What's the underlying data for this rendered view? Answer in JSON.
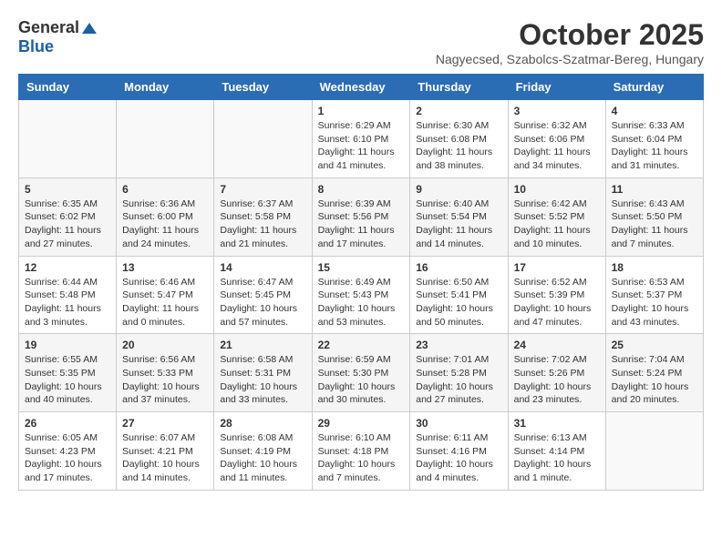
{
  "logo": {
    "general": "General",
    "blue": "Blue"
  },
  "title": "October 2025",
  "location": "Nagyecsed, Szabolcs-Szatmar-Bereg, Hungary",
  "headers": [
    "Sunday",
    "Monday",
    "Tuesday",
    "Wednesday",
    "Thursday",
    "Friday",
    "Saturday"
  ],
  "weeks": [
    [
      {
        "day": "",
        "info": ""
      },
      {
        "day": "",
        "info": ""
      },
      {
        "day": "",
        "info": ""
      },
      {
        "day": "1",
        "info": "Sunrise: 6:29 AM\nSunset: 6:10 PM\nDaylight: 11 hours\nand 41 minutes."
      },
      {
        "day": "2",
        "info": "Sunrise: 6:30 AM\nSunset: 6:08 PM\nDaylight: 11 hours\nand 38 minutes."
      },
      {
        "day": "3",
        "info": "Sunrise: 6:32 AM\nSunset: 6:06 PM\nDaylight: 11 hours\nand 34 minutes."
      },
      {
        "day": "4",
        "info": "Sunrise: 6:33 AM\nSunset: 6:04 PM\nDaylight: 11 hours\nand 31 minutes."
      }
    ],
    [
      {
        "day": "5",
        "info": "Sunrise: 6:35 AM\nSunset: 6:02 PM\nDaylight: 11 hours\nand 27 minutes."
      },
      {
        "day": "6",
        "info": "Sunrise: 6:36 AM\nSunset: 6:00 PM\nDaylight: 11 hours\nand 24 minutes."
      },
      {
        "day": "7",
        "info": "Sunrise: 6:37 AM\nSunset: 5:58 PM\nDaylight: 11 hours\nand 21 minutes."
      },
      {
        "day": "8",
        "info": "Sunrise: 6:39 AM\nSunset: 5:56 PM\nDaylight: 11 hours\nand 17 minutes."
      },
      {
        "day": "9",
        "info": "Sunrise: 6:40 AM\nSunset: 5:54 PM\nDaylight: 11 hours\nand 14 minutes."
      },
      {
        "day": "10",
        "info": "Sunrise: 6:42 AM\nSunset: 5:52 PM\nDaylight: 11 hours\nand 10 minutes."
      },
      {
        "day": "11",
        "info": "Sunrise: 6:43 AM\nSunset: 5:50 PM\nDaylight: 11 hours\nand 7 minutes."
      }
    ],
    [
      {
        "day": "12",
        "info": "Sunrise: 6:44 AM\nSunset: 5:48 PM\nDaylight: 11 hours\nand 3 minutes."
      },
      {
        "day": "13",
        "info": "Sunrise: 6:46 AM\nSunset: 5:47 PM\nDaylight: 11 hours\nand 0 minutes."
      },
      {
        "day": "14",
        "info": "Sunrise: 6:47 AM\nSunset: 5:45 PM\nDaylight: 10 hours\nand 57 minutes."
      },
      {
        "day": "15",
        "info": "Sunrise: 6:49 AM\nSunset: 5:43 PM\nDaylight: 10 hours\nand 53 minutes."
      },
      {
        "day": "16",
        "info": "Sunrise: 6:50 AM\nSunset: 5:41 PM\nDaylight: 10 hours\nand 50 minutes."
      },
      {
        "day": "17",
        "info": "Sunrise: 6:52 AM\nSunset: 5:39 PM\nDaylight: 10 hours\nand 47 minutes."
      },
      {
        "day": "18",
        "info": "Sunrise: 6:53 AM\nSunset: 5:37 PM\nDaylight: 10 hours\nand 43 minutes."
      }
    ],
    [
      {
        "day": "19",
        "info": "Sunrise: 6:55 AM\nSunset: 5:35 PM\nDaylight: 10 hours\nand 40 minutes."
      },
      {
        "day": "20",
        "info": "Sunrise: 6:56 AM\nSunset: 5:33 PM\nDaylight: 10 hours\nand 37 minutes."
      },
      {
        "day": "21",
        "info": "Sunrise: 6:58 AM\nSunset: 5:31 PM\nDaylight: 10 hours\nand 33 minutes."
      },
      {
        "day": "22",
        "info": "Sunrise: 6:59 AM\nSunset: 5:30 PM\nDaylight: 10 hours\nand 30 minutes."
      },
      {
        "day": "23",
        "info": "Sunrise: 7:01 AM\nSunset: 5:28 PM\nDaylight: 10 hours\nand 27 minutes."
      },
      {
        "day": "24",
        "info": "Sunrise: 7:02 AM\nSunset: 5:26 PM\nDaylight: 10 hours\nand 23 minutes."
      },
      {
        "day": "25",
        "info": "Sunrise: 7:04 AM\nSunset: 5:24 PM\nDaylight: 10 hours\nand 20 minutes."
      }
    ],
    [
      {
        "day": "26",
        "info": "Sunrise: 6:05 AM\nSunset: 4:23 PM\nDaylight: 10 hours\nand 17 minutes."
      },
      {
        "day": "27",
        "info": "Sunrise: 6:07 AM\nSunset: 4:21 PM\nDaylight: 10 hours\nand 14 minutes."
      },
      {
        "day": "28",
        "info": "Sunrise: 6:08 AM\nSunset: 4:19 PM\nDaylight: 10 hours\nand 11 minutes."
      },
      {
        "day": "29",
        "info": "Sunrise: 6:10 AM\nSunset: 4:18 PM\nDaylight: 10 hours\nand 7 minutes."
      },
      {
        "day": "30",
        "info": "Sunrise: 6:11 AM\nSunset: 4:16 PM\nDaylight: 10 hours\nand 4 minutes."
      },
      {
        "day": "31",
        "info": "Sunrise: 6:13 AM\nSunset: 4:14 PM\nDaylight: 10 hours\nand 1 minute."
      },
      {
        "day": "",
        "info": ""
      }
    ]
  ]
}
